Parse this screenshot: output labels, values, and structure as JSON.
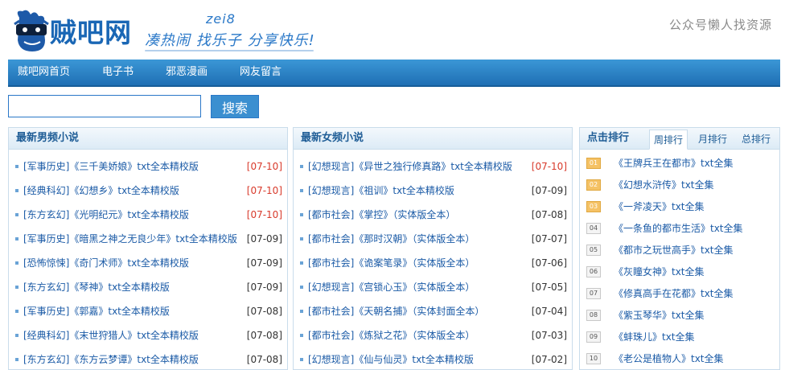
{
  "header": {
    "logo_text": "贼吧网",
    "slogan": "凑热闹 找乐子 分享快乐!",
    "slogan_sup": "zei8",
    "right_text": "公众号懒人找资源"
  },
  "nav": {
    "items": [
      {
        "label": "贼吧网首页"
      },
      {
        "label": "电子书"
      },
      {
        "label": "邪恶漫画"
      },
      {
        "label": "网友留言"
      }
    ]
  },
  "search": {
    "value": "",
    "placeholder": "",
    "button_label": "搜索"
  },
  "male_panel": {
    "title": "最新男频小说",
    "items": [
      {
        "title": "[军事历史]《三千美娇娘》txt全本精校版",
        "date": "[07-10]",
        "hot": true
      },
      {
        "title": "[经典科幻]《幻想乡》txt全本精校版",
        "date": "[07-10]",
        "hot": true
      },
      {
        "title": "[东方玄幻]《光明纪元》txt全本精校版",
        "date": "[07-10]",
        "hot": true
      },
      {
        "title": "[军事历史]《暗黑之神之无良少年》txt全本精校版",
        "date": "[07-09]",
        "hot": false
      },
      {
        "title": "[恐怖惊悚]《奇门术师》txt全本精校版",
        "date": "[07-09]",
        "hot": false
      },
      {
        "title": "[东方玄幻]《琴神》txt全本精校版",
        "date": "[07-09]",
        "hot": false
      },
      {
        "title": "[军事历史]《郭嘉》txt全本精校版",
        "date": "[07-08]",
        "hot": false
      },
      {
        "title": "[经典科幻]《末世狩猎人》txt全本精校版",
        "date": "[07-08]",
        "hot": false
      },
      {
        "title": "[东方玄幻]《东方云梦谭》txt全本精校版",
        "date": "[07-08]",
        "hot": false
      }
    ]
  },
  "female_panel": {
    "title": "最新女频小说",
    "items": [
      {
        "title": "[幻想现言]《异世之独行修真路》txt全本精校版",
        "date": "[07-10]",
        "hot": true
      },
      {
        "title": "[幻想现言]《祖训》txt全本精校版",
        "date": "[07-09]",
        "hot": false
      },
      {
        "title": "[都市社会]《掌控》（实体版全本）",
        "date": "[07-08]",
        "hot": false
      },
      {
        "title": "[都市社会]《那时汉朝》（实体版全本）",
        "date": "[07-07]",
        "hot": false
      },
      {
        "title": "[都市社会]《诡案笔录》（实体版全本）",
        "date": "[07-06]",
        "hot": false
      },
      {
        "title": "[幻想现言]《宫锁心玉》（实体版全本）",
        "date": "[07-05]",
        "hot": false
      },
      {
        "title": "[都市社会]《天朝名捕》（实体封面全本）",
        "date": "[07-04]",
        "hot": false
      },
      {
        "title": "[都市社会]《炼狱之花》（实体版全本）",
        "date": "[07-03]",
        "hot": false
      },
      {
        "title": "[幻想现言]《仙与仙灵》txt全本精校版",
        "date": "[07-02]",
        "hot": false
      }
    ]
  },
  "rank_panel": {
    "title": "点击排行",
    "tabs": [
      {
        "label": "周排行",
        "active": true
      },
      {
        "label": "月排行",
        "active": false
      },
      {
        "label": "总排行",
        "active": false
      }
    ],
    "items": [
      {
        "rank": "01",
        "title": "《王牌兵王在都市》txt全集"
      },
      {
        "rank": "02",
        "title": "《幻想水浒传》txt全集"
      },
      {
        "rank": "03",
        "title": "《一斧凌天》txt全集"
      },
      {
        "rank": "04",
        "title": "《一条鱼的都市生活》txt全集"
      },
      {
        "rank": "05",
        "title": "《都市之玩世高手》txt全集"
      },
      {
        "rank": "06",
        "title": "《灰瞳女神》txt全集"
      },
      {
        "rank": "07",
        "title": "《修真高手在花都》txt全集"
      },
      {
        "rank": "08",
        "title": "《紫玉琴华》txt全集"
      },
      {
        "rank": "09",
        "title": "《蚌珠儿》txt全集"
      },
      {
        "rank": "10",
        "title": "《老公是植物人》txt全集"
      }
    ]
  },
  "colors": {
    "nav_bg": "#1f6fb4",
    "link": "#1a5aa6",
    "hot_date": "#d83a2b",
    "rank_top": "#f5c265"
  }
}
